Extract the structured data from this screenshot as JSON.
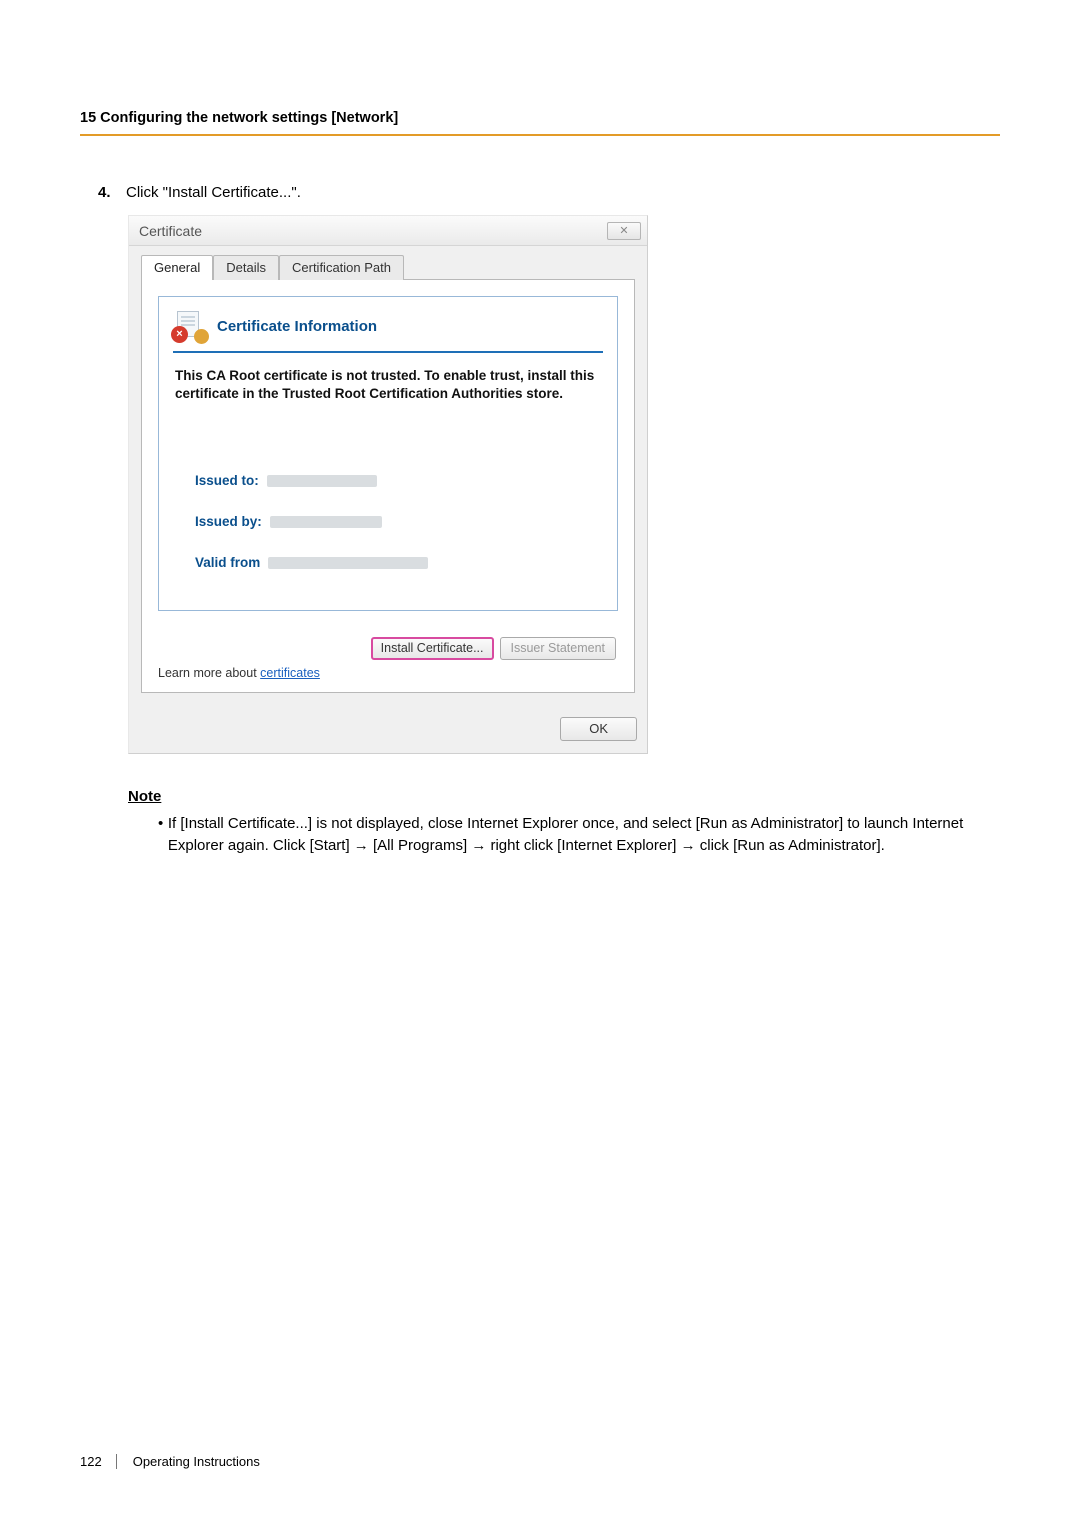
{
  "section_header": "15 Configuring the network settings [Network]",
  "step": {
    "number": "4.",
    "text": "Click \"Install Certificate...\"."
  },
  "dialog": {
    "title": "Certificate",
    "close_glyph": "✕",
    "tabs": {
      "general": "General",
      "details": "Details",
      "path": "Certification Path"
    },
    "info_title": "Certificate Information",
    "trust_text": "This CA Root certificate is not trusted. To enable trust, install this certificate in the Trusted Root Certification Authorities store.",
    "issued_to_label": "Issued to:",
    "issued_by_label": "Issued by:",
    "valid_from_label": "Valid from",
    "install_btn": "Install Certificate...",
    "issuer_btn": "Issuer Statement",
    "learn_prefix": "Learn more about ",
    "learn_link": "certificates",
    "ok": "OK"
  },
  "note": {
    "heading": "Note",
    "bullet_text_1": "If [Install Certificate...] is not displayed, close Internet Explorer once, and select [Run as Administrator] to launch Internet Explorer again. Click [Start] ",
    "arrow": "→",
    "bullet_text_2": " [All Programs] ",
    "bullet_text_3": " right click [Internet Explorer] ",
    "bullet_text_4": " click [Run as Administrator]."
  },
  "footer": {
    "page": "122",
    "label": "Operating Instructions"
  }
}
